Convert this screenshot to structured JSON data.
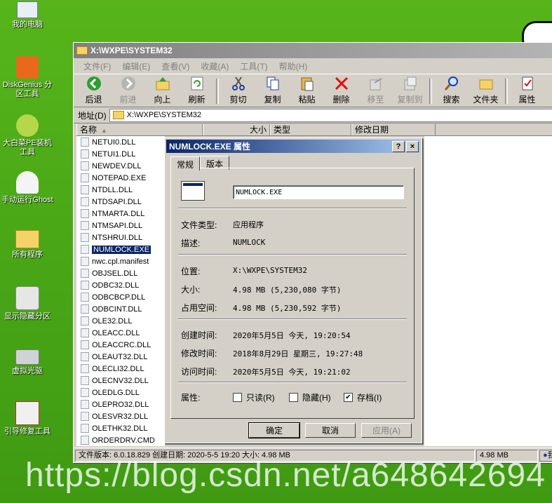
{
  "desktop": {
    "icons": [
      {
        "label": "我的电脑"
      },
      {
        "label": "DiskGenius 分区工具"
      },
      {
        "label": "大白菜PE装机工具"
      },
      {
        "label": "手动运行Ghost"
      },
      {
        "label": "所有程序"
      },
      {
        "label": "显示隐藏分区"
      },
      {
        "label": "虚拟光驱"
      },
      {
        "label": "引导修复工具"
      }
    ]
  },
  "window": {
    "title": "X:\\WXPE\\SYSTEM32",
    "menu": [
      "文件(F)",
      "编辑(E)",
      "查看(V)",
      "收藏(A)",
      "工具(T)",
      "帮助(H)"
    ],
    "toolbar": {
      "back": "后退",
      "forward": "前进",
      "up": "向上",
      "refresh": "刷新",
      "cut": "剪切",
      "copy": "复制",
      "paste": "粘贴",
      "delete": "删除",
      "move": "移至",
      "copyto": "复制到",
      "search": "搜索",
      "folders": "文件夹",
      "properties": "属性"
    },
    "address": {
      "label": "地址(D)",
      "value": "X:\\WXPE\\SYSTEM32"
    },
    "columns": {
      "name": "名称",
      "size": "大小",
      "type": "类型",
      "modified": "修改日期"
    },
    "files": [
      "NETUI0.DLL",
      "NETUI1.DLL",
      "NEWDEV.DLL",
      "NOTEPAD.EXE",
      "NTDLL.DLL",
      "NTDSAPI.DLL",
      "NTMARTA.DLL",
      "NTMSAPI.DLL",
      "NTSHRUI.DLL",
      "NUMLOCK.EXE",
      "nwc.cpl.manifest",
      "OBJSEL.DLL",
      "ODBC32.DLL",
      "ODBCBCP.DLL",
      "ODBCINT.DLL",
      "OLE32.DLL",
      "OLEACC.DLL",
      "OLEACCRC.DLL",
      "OLEAUT32.DLL",
      "OLECLI32.DLL",
      "OLECNV32.DLL",
      "OLEDLG.DLL",
      "OLEPRO32.DLL",
      "OLESVR32.DLL",
      "OLETHK32.DLL",
      "ORDERDRV.CMD"
    ],
    "status": {
      "info": "文件版本: 6.0.18.829 创建日期: 2020-5-5 19:20 大小: 4.98 MB",
      "size": "4.98 MB",
      "zone": "我"
    }
  },
  "dialog": {
    "title": "NUMLOCK.EXE 属性",
    "help_btn": "?",
    "close_btn": "×",
    "tabs": [
      "常规",
      "版本"
    ],
    "filename": "NUMLOCK.EXE",
    "rows": {
      "type_label": "文件类型:",
      "type_value": "应用程序",
      "desc_label": "描述:",
      "desc_value": "NUMLOCK",
      "loc_label": "位置:",
      "loc_value": "X:\\WXPE\\SYSTEM32",
      "size_label": "大小:",
      "size_value": "4.98 MB (5,230,080 字节)",
      "disk_label": "占用空间:",
      "disk_value": "4.98 MB (5,230,592 字节)",
      "created_label": "创建时间:",
      "created_value": "2020年5月5日 今天, 19:20:54",
      "modified_label": "修改时间:",
      "modified_value": "2018年8月29日 星期三, 19:27:48",
      "accessed_label": "访问时间:",
      "accessed_value": "2020年5月5日 今天, 19:21:02",
      "attr_label": "属性:"
    },
    "attributes": {
      "readonly": "只读(R)",
      "hidden": "隐藏(H)",
      "archive": "存档(I)",
      "archive_check": "✔"
    },
    "buttons": {
      "ok": "确定",
      "cancel": "取消",
      "apply": "应用(A)"
    }
  },
  "watermark": "https://blog.csdn.net/a648642694"
}
